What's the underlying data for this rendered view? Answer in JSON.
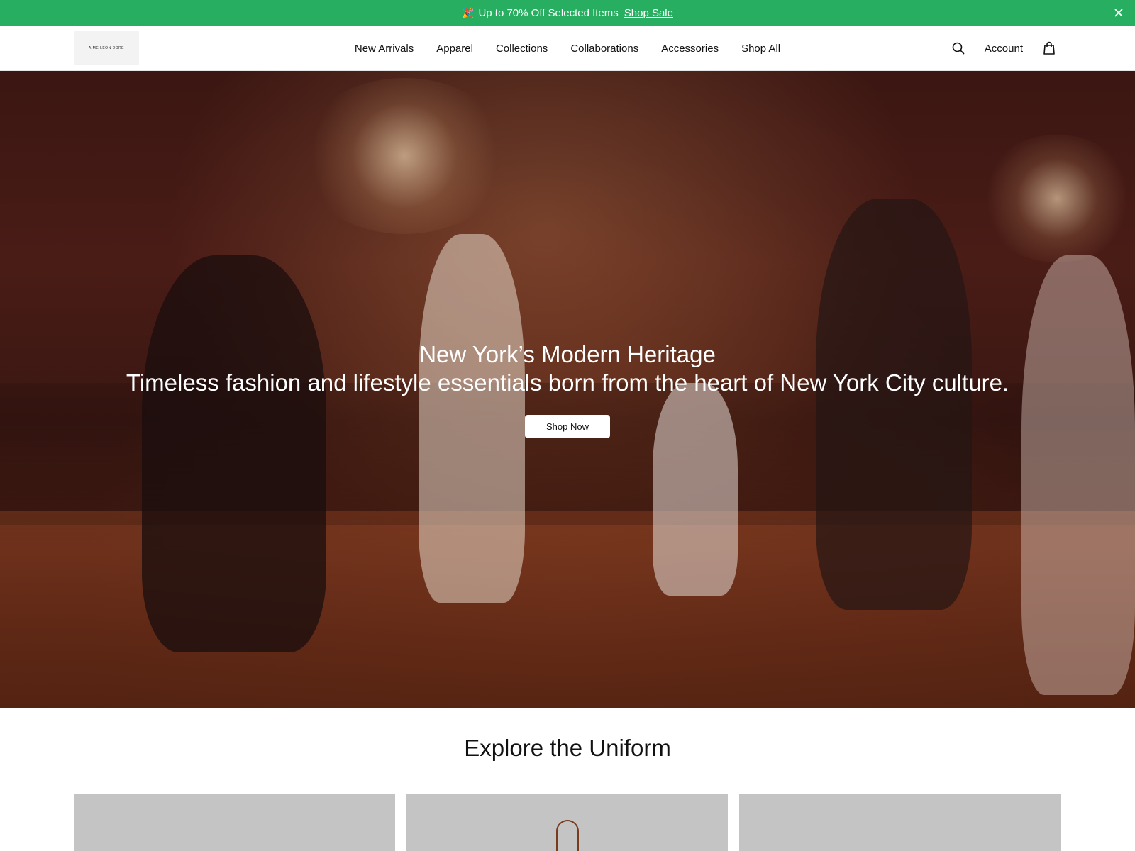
{
  "announcement": {
    "emoji": "🎉",
    "text": "Up to 70% Off Selected Items",
    "link_label": "Shop Sale"
  },
  "header": {
    "logo_text": "AIME LEON DORE",
    "nav": [
      {
        "label": "New Arrivals"
      },
      {
        "label": "Apparel"
      },
      {
        "label": "Collections"
      },
      {
        "label": "Collaborations"
      },
      {
        "label": "Accessories"
      },
      {
        "label": "Shop All"
      }
    ],
    "account_label": "Account"
  },
  "hero": {
    "title": "New York’s Modern Heritage",
    "subtitle": "Timeless fashion and lifestyle essentials born from the heart of New York City culture.",
    "cta_label": "Shop Now"
  },
  "explore": {
    "title": "Explore the Uniform"
  },
  "colors": {
    "announcement_bg": "#27ae60",
    "card_bg": "#c4c4c4"
  },
  "icons": [
    "party-icon",
    "close-icon",
    "search-icon",
    "bag-icon",
    "strap-icon"
  ]
}
